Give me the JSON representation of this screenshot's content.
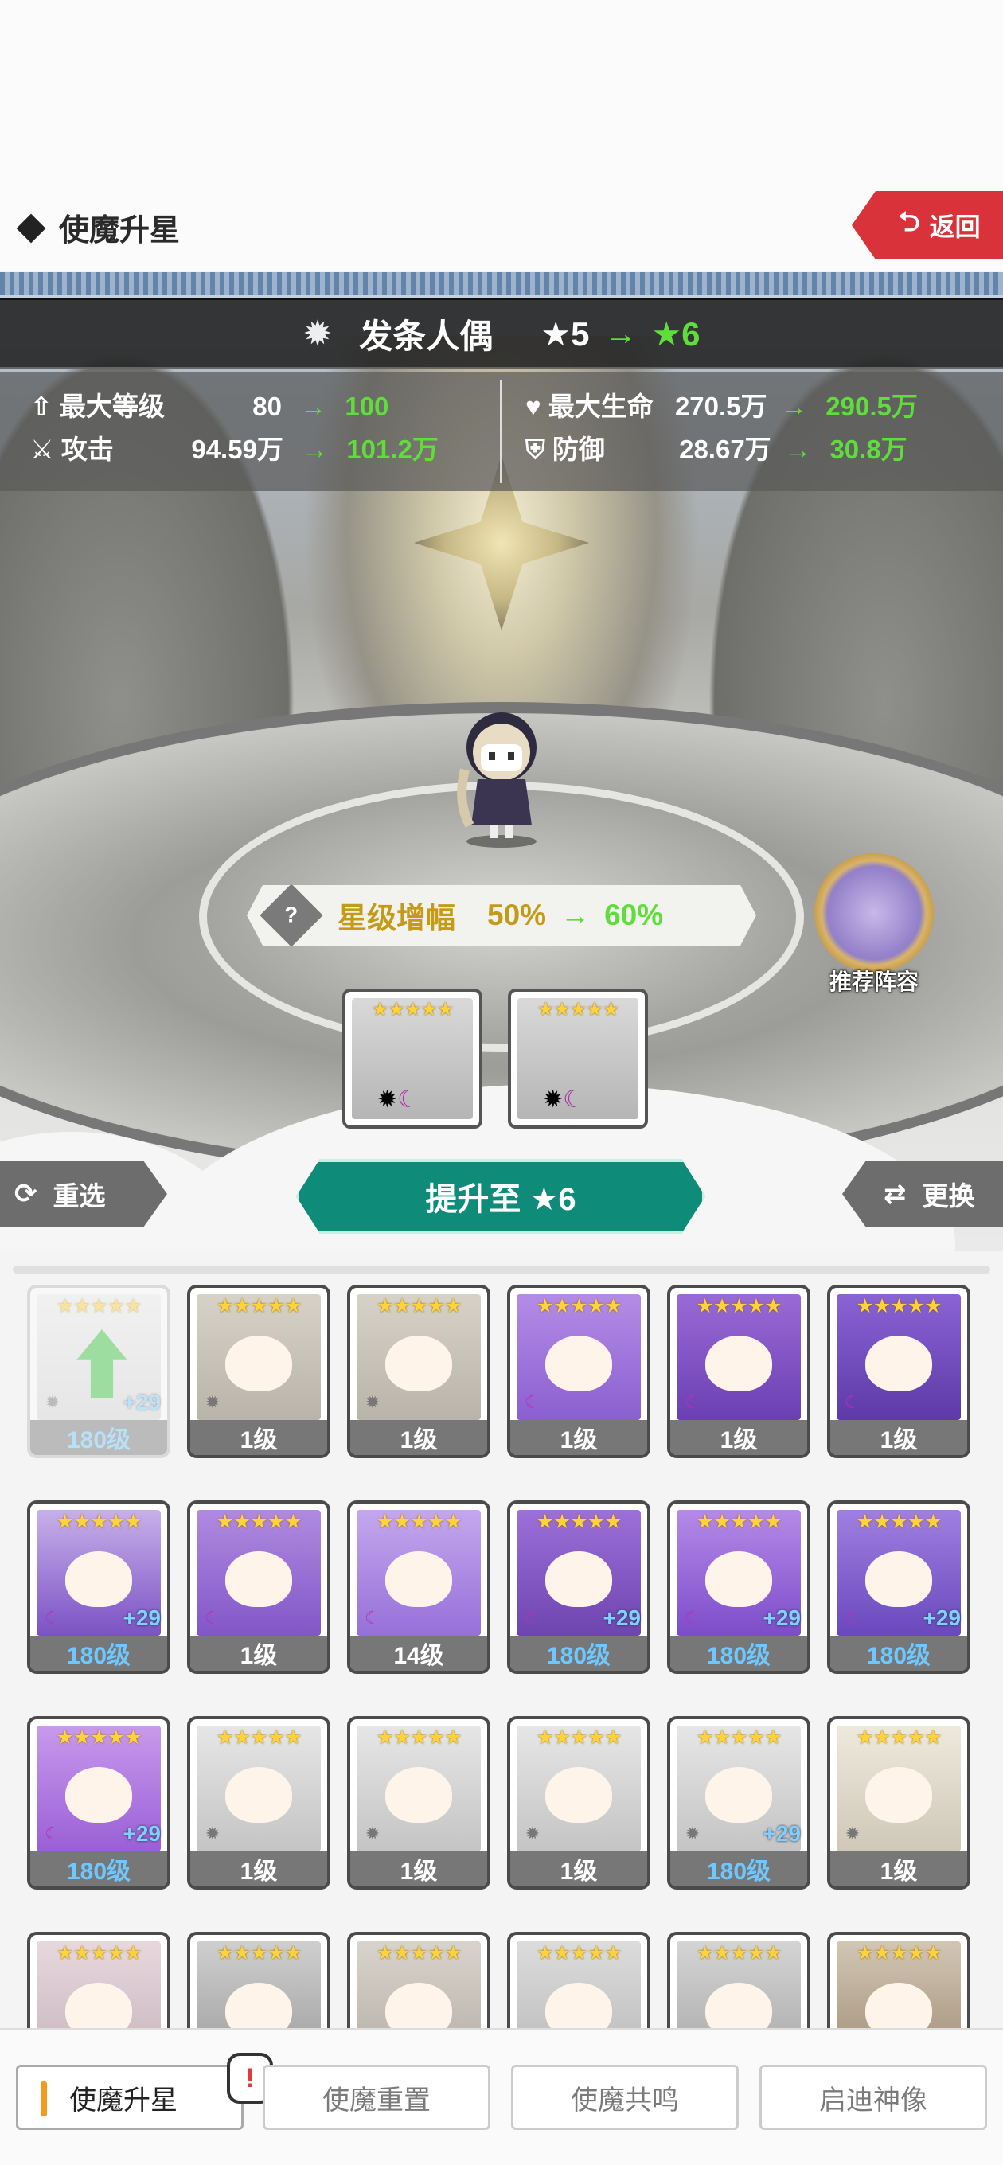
{
  "page": {
    "title": "使魔升星",
    "back_label": "返回"
  },
  "familiar": {
    "name": "发条人偶",
    "star_from": "★5",
    "arrow": "→",
    "star_to": "★6"
  },
  "stats": {
    "max_level": {
      "label": "最大等级",
      "from": "80",
      "to": "100"
    },
    "attack": {
      "label": "攻击",
      "from": "94.59万",
      "to": "101.2万"
    },
    "max_hp": {
      "label": "最大生命",
      "from": "270.5万",
      "to": "290.5万"
    },
    "defense": {
      "label": "防御",
      "from": "28.67万",
      "to": "30.8万"
    },
    "arrow": "→"
  },
  "bonus": {
    "label": "星级增幅",
    "from": "50%",
    "to": "60%",
    "help_icon": "?"
  },
  "recommend": {
    "label": "推荐阵容"
  },
  "materials": [
    {
      "stars": "★★★★★"
    },
    {
      "stars": "★★★★★"
    }
  ],
  "buttons": {
    "reselect": "重选",
    "promote": "提升至 ★6",
    "swap": "更换"
  },
  "colors": {
    "accent_teal": "#0f8b7a",
    "back_red": "#d9323a",
    "arrow_green": "#5fdd3a",
    "level_blue": "#6ec8ff",
    "tab_orange": "#f39a1d"
  },
  "grid": [
    {
      "stars": "★★★★★",
      "level": "180级",
      "plus": "+29",
      "variant": "upgrade",
      "disabled": true
    },
    {
      "stars": "★★★★★",
      "level": "1级",
      "plus": "",
      "variant": "doll"
    },
    {
      "stars": "★★★★★",
      "level": "1级",
      "plus": "",
      "variant": "doll"
    },
    {
      "stars": "★★★★★",
      "level": "1级",
      "plus": "",
      "variant": "bunny"
    },
    {
      "stars": "★★★★★",
      "level": "1级",
      "plus": "",
      "variant": "purple-king"
    },
    {
      "stars": "★★★★★",
      "level": "1级",
      "plus": "",
      "variant": "purple-hood"
    },
    {
      "stars": "★★★★★",
      "level": "180级",
      "plus": "+29",
      "variant": "dog"
    },
    {
      "stars": "★★★★★",
      "level": "1级",
      "plus": "",
      "variant": "purple-girl"
    },
    {
      "stars": "★★★★★",
      "level": "14级",
      "plus": "",
      "variant": "purple-cat"
    },
    {
      "stars": "★★★★★",
      "level": "180级",
      "plus": "+29",
      "variant": "purple-flower"
    },
    {
      "stars": "★★★★★",
      "level": "180级",
      "plus": "+29",
      "variant": "purple-knight"
    },
    {
      "stars": "★★★★★",
      "level": "180级",
      "plus": "+29",
      "variant": "purple-robot"
    },
    {
      "stars": "★★★★★",
      "level": "180级",
      "plus": "+29",
      "variant": "purple-fairy"
    },
    {
      "stars": "★★★★★",
      "level": "1级",
      "plus": "",
      "variant": "white-elf"
    },
    {
      "stars": "★★★★★",
      "level": "1级",
      "plus": "",
      "variant": "white-elf"
    },
    {
      "stars": "★★★★★",
      "level": "1级",
      "plus": "",
      "variant": "white-elf"
    },
    {
      "stars": "★★★★★",
      "level": "180级",
      "plus": "+29",
      "variant": "white-elf"
    },
    {
      "stars": "★★★★★",
      "level": "1级",
      "plus": "",
      "variant": "white-horn"
    },
    {
      "stars": "★★★★★",
      "level": "",
      "plus": "",
      "variant": "grey-a"
    },
    {
      "stars": "★★★★★",
      "level": "",
      "plus": "",
      "variant": "grey-b"
    },
    {
      "stars": "★★★★★",
      "level": "",
      "plus": "",
      "variant": "grey-c"
    },
    {
      "stars": "★★★★★",
      "level": "",
      "plus": "",
      "variant": "grey-d"
    },
    {
      "stars": "★★★★★",
      "level": "",
      "plus": "",
      "variant": "grey-e"
    },
    {
      "stars": "★★★★★",
      "level": "",
      "plus": "",
      "variant": "grey-f"
    }
  ],
  "tabs": [
    {
      "label": "使魔升星",
      "active": true
    },
    {
      "label": "使魔重置",
      "active": false
    },
    {
      "label": "使魔共鸣",
      "active": false
    },
    {
      "label": "启迪神像",
      "active": false
    }
  ],
  "notification_mark": "!"
}
